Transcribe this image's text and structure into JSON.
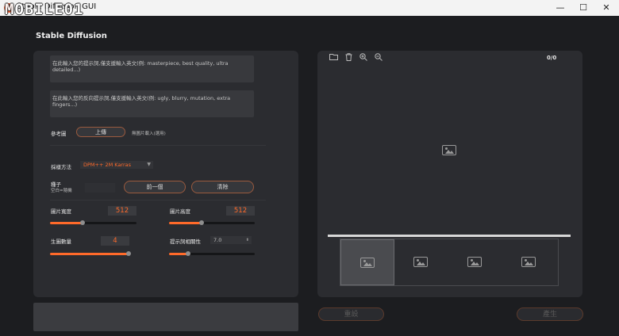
{
  "titlebar": {
    "title": "Stable Diffusion GUI",
    "watermark": "MOBILE01",
    "minimize": "—",
    "maximize": "☐",
    "close": "✕"
  },
  "app": {
    "heading": "Stable Diffusion"
  },
  "prompts": {
    "positive_placeholder": "在此輸入您的提示詞,僅支援輸入英文(例: masterpiece, best quality, ultra detailed...)",
    "negative_placeholder": "在此輸入您的反向提示詞,僅支援輸入英文(例: ugly, blurry, mutation, extra fingers...)"
  },
  "reference": {
    "label": "參考圖",
    "upload_button": "上傳",
    "status": "無圖片載入(選用)"
  },
  "sampler": {
    "label": "採樣方法",
    "value": "DPM++ 2M Karras"
  },
  "seed": {
    "label": "種子",
    "hint": "空白=隨機",
    "value": "",
    "prev_button": "前一個",
    "clear_button": "清除"
  },
  "width": {
    "label": "圖片寬度",
    "value": "512",
    "fraction": 0.38
  },
  "height": {
    "label": "圖片高度",
    "value": "512",
    "fraction": 0.38
  },
  "count": {
    "label": "生圖數量",
    "value": "4",
    "fraction": 1.0
  },
  "cfg": {
    "label": "提示詞相關性",
    "value": "7.0",
    "fraction": 0.22
  },
  "preview": {
    "counter": "0/0",
    "tools": [
      "folder-icon",
      "trash-icon",
      "zoom-in-icon",
      "zoom-out-icon"
    ],
    "progress": 1.0
  },
  "thumbnails": [
    {
      "selected": true
    },
    {
      "selected": false
    },
    {
      "selected": false
    },
    {
      "selected": false
    }
  ],
  "actions": {
    "reset_button": "重設",
    "generate_button": "產生"
  },
  "colors": {
    "accent": "#ff6a2a",
    "panel": "#2b2c30",
    "background": "#1c1d20"
  }
}
